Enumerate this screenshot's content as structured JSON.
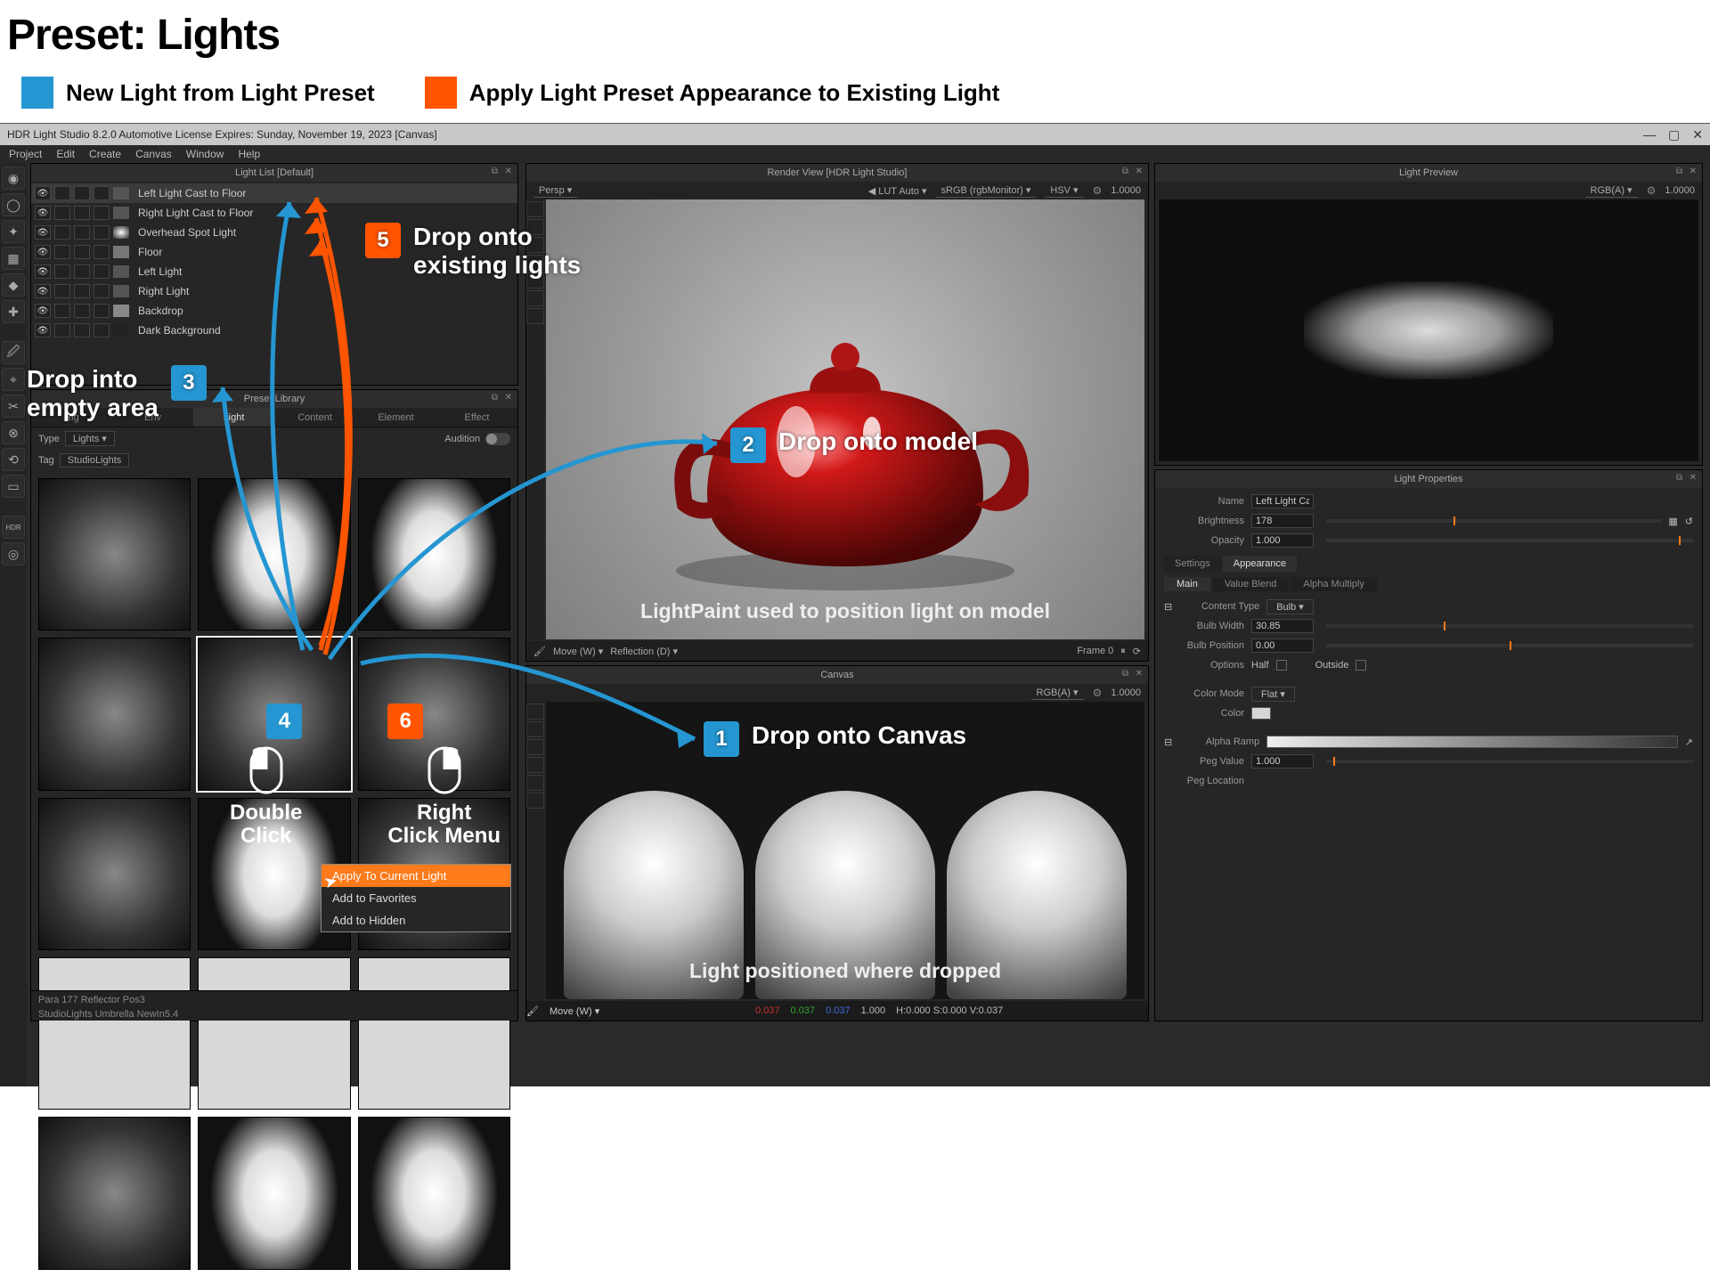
{
  "tutorial": {
    "title": "Preset: Lights",
    "legend_new": "New Light from Light Preset",
    "legend_apply": "Apply Light Preset Appearance to Existing Light",
    "callouts": {
      "c1": "Drop onto Canvas",
      "c2": "Drop onto model",
      "c3": "Drop into\nempty area",
      "c45a": "Double\nClick",
      "c45b": "Right\nClick Menu",
      "c5": "Drop onto\nexisting lights",
      "rv_note": "LightPaint used to position light on model",
      "cv_note": "Light positioned where dropped"
    }
  },
  "titlebar": "HDR Light Studio 8.2.0   Automotive License Expires: Sunday, November 19, 2023   [Canvas]",
  "menu": [
    "Project",
    "Edit",
    "Create",
    "Canvas",
    "Window",
    "Help"
  ],
  "panels": {
    "lightlist_title": "Light List [Default]",
    "presetlib_title": "Preset Library",
    "renderview_title": "Render View [HDR Light Studio]",
    "canvas_title": "Canvas",
    "lightpreview_title": "Light Preview",
    "lightprops_title": "Light Properties"
  },
  "light_list": [
    "Left Light Cast to Floor",
    "Right Light Cast to Floor",
    "Overhead Spot Light",
    "Floor",
    "Left Light",
    "Right Light",
    "Backdrop",
    "Dark Background"
  ],
  "presetlib": {
    "tabs": [
      "Rig",
      "Env",
      "Light",
      "Content",
      "Element",
      "Effect"
    ],
    "active_tab": "Light",
    "type_label": "Type",
    "type_value": "Lights",
    "tag_label": "Tag",
    "tag_value": "StudioLights",
    "audition_label": "Audition",
    "status1": "Para 177 Reflector Pos3",
    "status2": "StudioLights Umbrella NewIn5.4"
  },
  "context_menu": [
    "Apply To Current Light",
    "Add to Favorites",
    "Add to Hidden"
  ],
  "renderview": {
    "persp": "Persp",
    "lut": "LUT Auto",
    "srgb": "sRGB (rgbMonitor)",
    "hsv": "HSV",
    "exposure": "1.0000",
    "move": "Move (W)",
    "reflection": "Reflection (D)",
    "frame": "Frame 0"
  },
  "canvas": {
    "rgba": "RGB(A)",
    "exposure": "1.0000",
    "move": "Move (W)",
    "footer_r": "0.037",
    "footer_g": "0.037",
    "footer_b": "0.037",
    "footer_a": "1.000",
    "footer_hsv": "H:0.000 S:0.000 V:0.037"
  },
  "lightpreview": {
    "rgba": "RGB(A)",
    "exposure": "1.0000"
  },
  "lightprops": {
    "name_label": "Name",
    "name_value": "Left Light Cast to Floor",
    "brightness_label": "Brightness",
    "brightness_value": "178",
    "opacity_label": "Opacity",
    "opacity_value": "1.000",
    "tabs": [
      "Settings",
      "Appearance"
    ],
    "subtabs": [
      "Main",
      "Value Blend",
      "Alpha Multiply"
    ],
    "content_type_label": "Content Type",
    "content_type_value": "Bulb",
    "bulb_width_label": "Bulb Width",
    "bulb_width_value": "30.85",
    "bulb_position_label": "Bulb Position",
    "bulb_position_value": "0.00",
    "options_label": "Options",
    "opt_half": "Half",
    "opt_outside": "Outside",
    "color_mode_label": "Color Mode",
    "color_mode_value": "Flat",
    "color_label": "Color",
    "alpha_ramp_label": "Alpha Ramp",
    "peg_value_label": "Peg Value",
    "peg_value": "1.000",
    "peg_location_label": "Peg Location"
  }
}
